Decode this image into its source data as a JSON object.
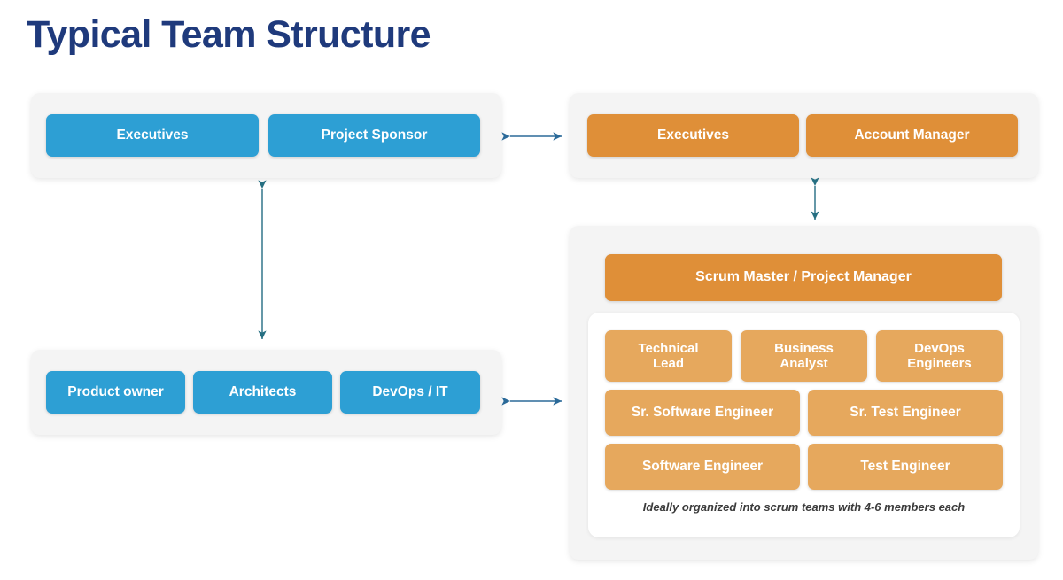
{
  "title": "Typical Team Structure",
  "colors": {
    "title_navy": "#1f3a7c",
    "blue": "#2d9fd4",
    "orange_dark": "#df8f38",
    "orange_light": "#e6a85d",
    "panel_gray": "#f4f4f4",
    "arrow": "#2b6a99"
  },
  "client_leadership": {
    "panel_name": "client-leadership-panel",
    "boxes": [
      {
        "label": "Executives"
      },
      {
        "label": "Project Sponsor"
      }
    ]
  },
  "vendor_leadership": {
    "panel_name": "vendor-leadership-panel",
    "boxes": [
      {
        "label": "Executives"
      },
      {
        "label": "Account Manager"
      }
    ]
  },
  "client_delivery": {
    "panel_name": "client-delivery-panel",
    "boxes": [
      {
        "label": "Product owner"
      },
      {
        "label": "Architects"
      },
      {
        "label": "DevOps / IT"
      }
    ]
  },
  "delivery_team": {
    "panel_name": "delivery-team-panel",
    "lead": {
      "label": "Scrum Master / Project Manager"
    },
    "row1": [
      {
        "label": "Technical\nLead"
      },
      {
        "label": "Business\nAnalyst"
      },
      {
        "label": "DevOps\nEngineers"
      }
    ],
    "row2": [
      {
        "label": "Sr. Software Engineer"
      },
      {
        "label": "Sr. Test Engineer"
      }
    ],
    "row3": [
      {
        "label": "Software Engineer"
      },
      {
        "label": "Test Engineer"
      }
    ],
    "caption": "Ideally organized into scrum teams with 4-6 members each"
  },
  "connectors": [
    {
      "name": "leadership-horizontal-connector",
      "direction": "bidirectional-horizontal"
    },
    {
      "name": "client-vertical-connector",
      "direction": "bidirectional-vertical"
    },
    {
      "name": "vendor-vertical-connector",
      "direction": "bidirectional-vertical"
    },
    {
      "name": "delivery-horizontal-connector",
      "direction": "bidirectional-horizontal"
    }
  ]
}
